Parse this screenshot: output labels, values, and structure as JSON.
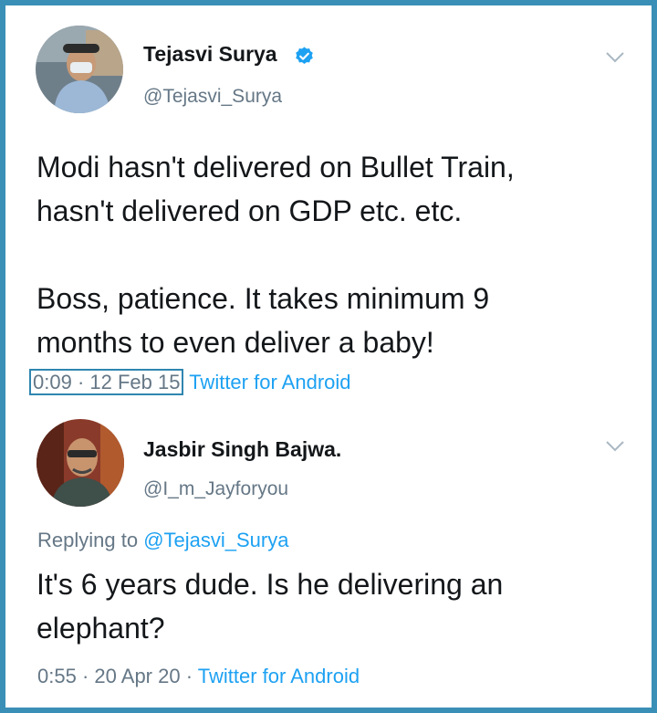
{
  "tweet1": {
    "name": "Tejasvi Surya",
    "handle": "@Tejasvi_Surya",
    "text_line1": "Modi hasn't delivered on Bullet Train,",
    "text_line2": "hasn't delivered on GDP etc. etc.",
    "text_line3": "Boss, patience. It takes minimum 9",
    "text_line4": "months to even deliver a baby!",
    "time": "0:09",
    "date": "12 Feb 15",
    "separator": "·",
    "source": "Twitter for Android",
    "verified_icon": "verified-badge-icon",
    "menu_icon": "chevron-down-icon"
  },
  "tweet2": {
    "name": "Jasbir Singh Bajwa.",
    "handle": "@I_m_Jayforyou",
    "replying_prefix": "Replying to ",
    "replying_to": "@Tejasvi_Surya",
    "text_line1": "It's 6 years dude. Is he delivering an",
    "text_line2": "elephant?",
    "time": "0:55",
    "date": "20 Apr 20",
    "separator": "·",
    "source": "Twitter for Android",
    "menu_icon": "chevron-down-icon"
  },
  "colors": {
    "border": "#3a8fb7",
    "link": "#1da1f2",
    "muted": "#657786",
    "text": "#14171a"
  }
}
